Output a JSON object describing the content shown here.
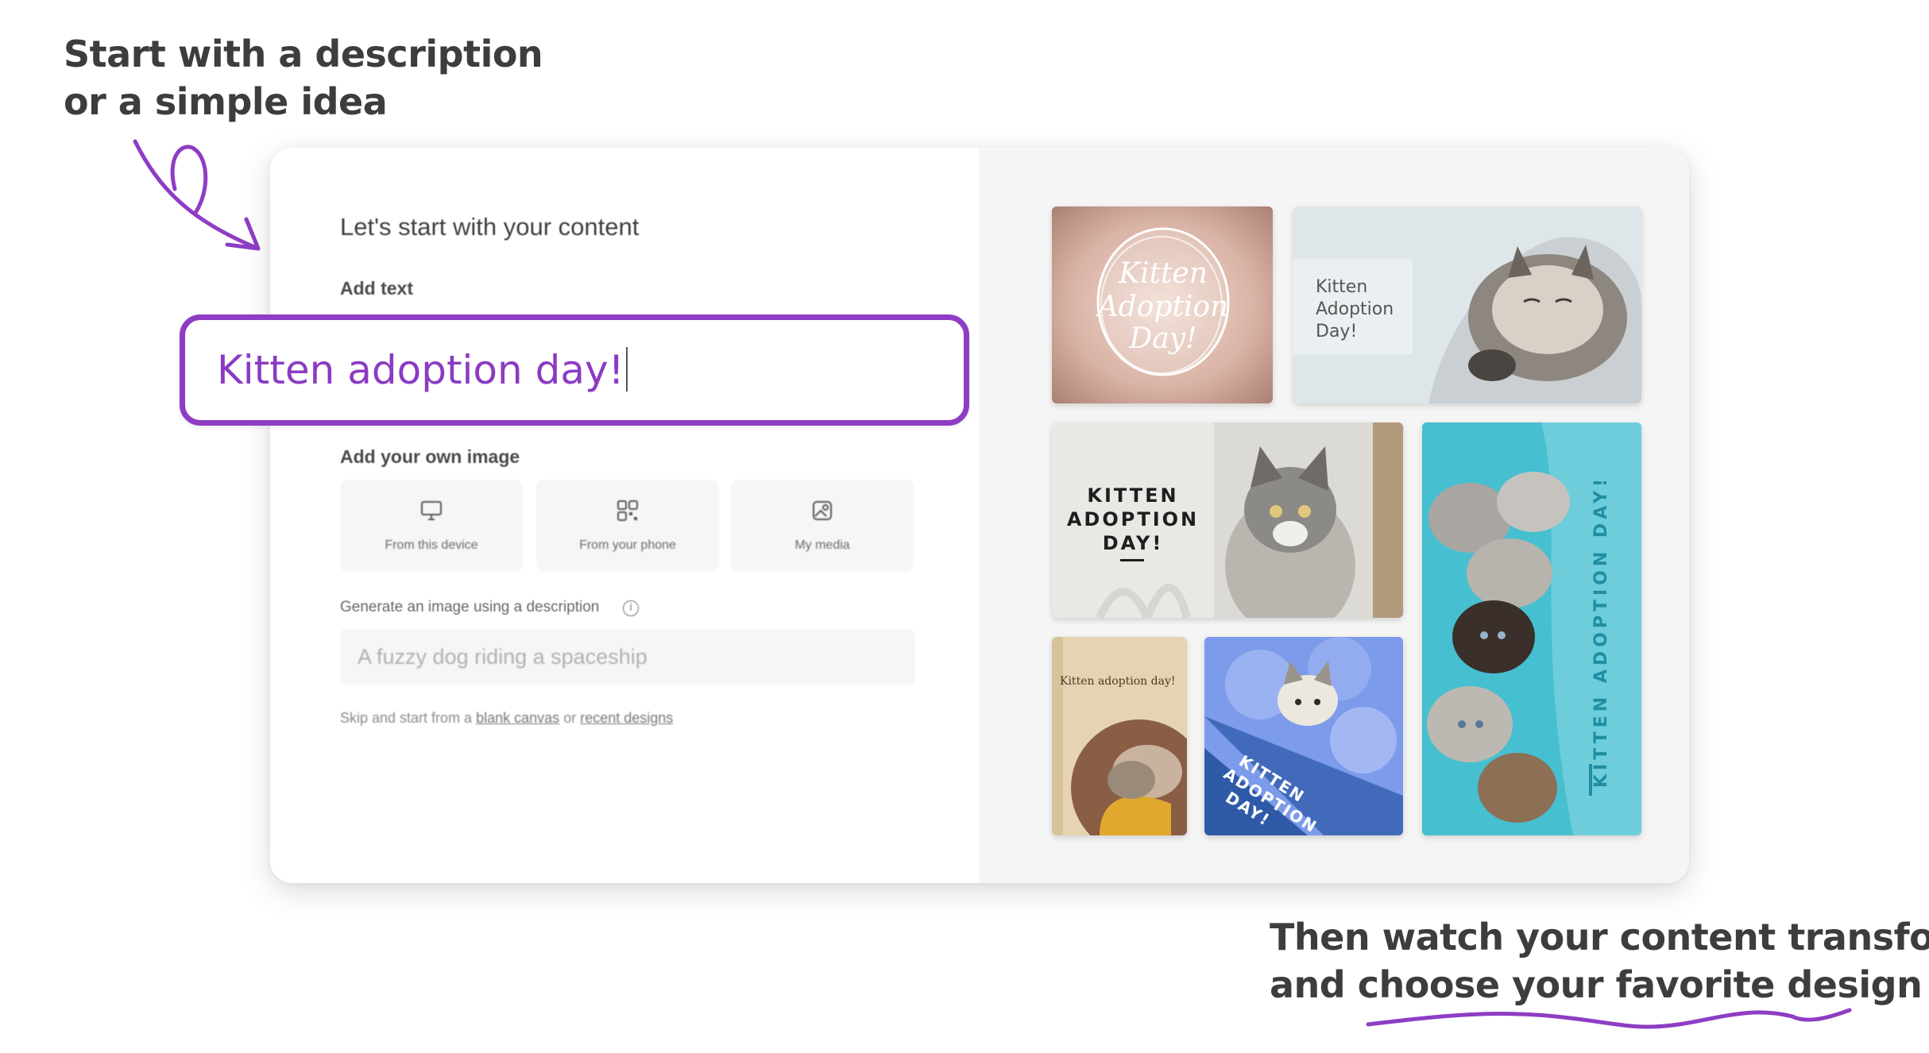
{
  "captions": {
    "top": [
      "Start with a description",
      "or a simple idea"
    ],
    "bottom": [
      "Then watch your content transform",
      "and choose your favorite design"
    ]
  },
  "form": {
    "heading": "Let's start with your content",
    "add_text_label": "Add text",
    "text_value": "Kitten adoption day!",
    "add_image_label": "Add your own image",
    "upload_options": [
      {
        "label": "From this device",
        "icon": "monitor-icon"
      },
      {
        "label": "From your phone",
        "icon": "qr-code-icon"
      },
      {
        "label": "My media",
        "icon": "image-gallery-icon"
      }
    ],
    "generate_label": "Generate an image using a description",
    "generate_placeholder": "A fuzzy dog riding a spaceship",
    "skip_prefix": "Skip and start from a",
    "blank_canvas_link": "blank canvas",
    "or_text": "or",
    "recent_designs_link": "recent designs"
  },
  "designs": [
    {
      "title": "Kitten Adoption Day!",
      "style": "script"
    },
    {
      "title": "Kitten Adoption Day!",
      "style": "sans-left"
    },
    {
      "title": "KITTEN ADOPTION DAY!",
      "style": "bold-caps"
    },
    {
      "title": "KITTEN ADOPTION DAY!",
      "style": "vertical"
    },
    {
      "title": "Kitten adoption day!",
      "style": "serif-small"
    },
    {
      "title_lines": [
        "KITTEN",
        "ADOPTION",
        "DAY!"
      ],
      "style": "diagonal"
    }
  ],
  "colors": {
    "accent_purple": "#8e3dc4",
    "caption_gray": "#3d3d3d",
    "teal_blanket": "#3fb6c9",
    "blue_knit": "#7c9bea"
  }
}
